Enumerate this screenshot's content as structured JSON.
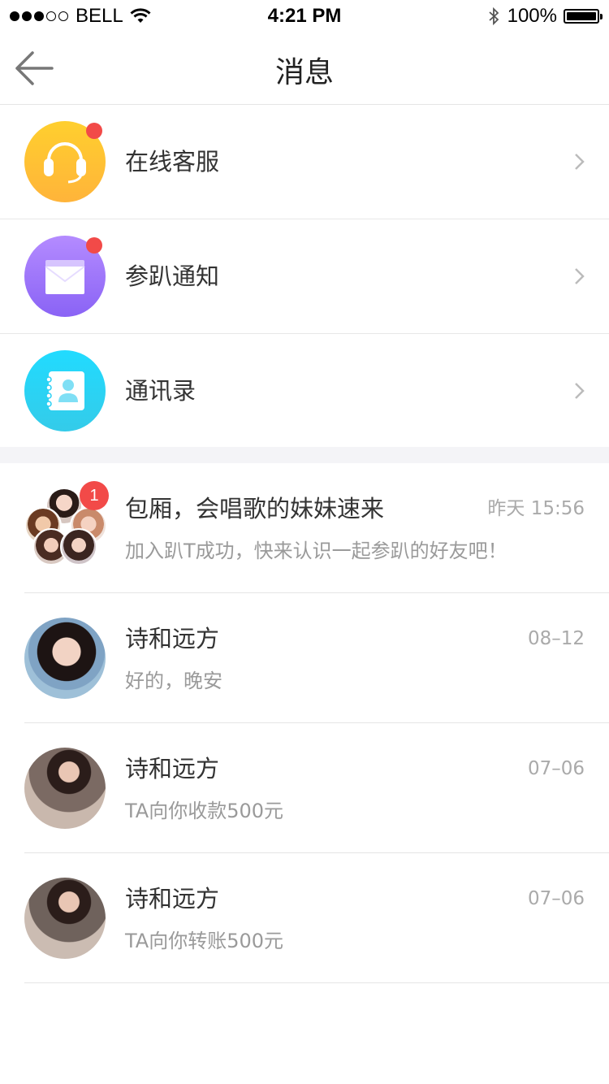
{
  "status_bar": {
    "carrier": "BELL",
    "time": "4:21 PM",
    "battery": "100%"
  },
  "nav": {
    "title": "消息"
  },
  "menu": [
    {
      "label": "在线客服",
      "icon": "headset-icon",
      "colors": [
        "#ffcc2e",
        "#ffb43a"
      ],
      "unread": true
    },
    {
      "label": "参趴通知",
      "icon": "envelope-icon",
      "colors": [
        "#b48bff",
        "#8a63f5"
      ],
      "unread": true
    },
    {
      "label": "通讯录",
      "icon": "contacts-book-icon",
      "colors": [
        "#21dbff",
        "#34cbe9"
      ],
      "unread": false
    }
  ],
  "chats": [
    {
      "name": "包厢，会唱歌的妹妹速来",
      "time": "昨天 15:56",
      "message": "加入趴T成功，快来认识一起参趴的好友吧！",
      "badge": "1",
      "type": "group"
    },
    {
      "name": "诗和远方",
      "time": "08–12",
      "message": "好的，晚安",
      "type": "single"
    },
    {
      "name": "诗和远方",
      "time": "07–06",
      "message": "TA向你收款500元",
      "type": "single"
    },
    {
      "name": "诗和远方",
      "time": "07–06",
      "message": "TA向你转账500元",
      "type": "single"
    }
  ],
  "colors": {
    "accent_red": "#f24a48",
    "divider": "#e5e5e5",
    "section_gap": "#f4f4f7"
  }
}
